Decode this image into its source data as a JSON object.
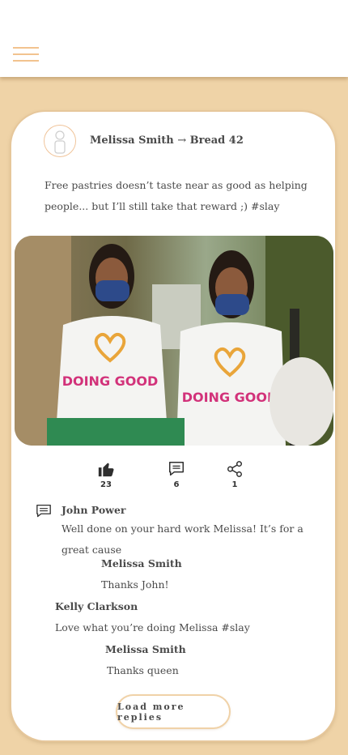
{
  "post": {
    "author": "Melissa Smith",
    "arrow": "→",
    "recipient": "Bread 42",
    "text": "Free pastries doesn’t taste near as good as helping people... but I’ll still take that reward ;) #slay",
    "image_alt": "Two volunteers in masks and DOING GOOD t-shirts holding a green bin and trash bag"
  },
  "stats": {
    "likes": "23",
    "comments": "6",
    "shares": "1"
  },
  "comments": [
    {
      "name": "John Power",
      "text": "Well done on your hard work Melissa! It’s for a great cause",
      "reply": {
        "name": "Melissa Smith",
        "text": "Thanks John!"
      }
    },
    {
      "name": "Kelly Clarkson",
      "text": "Love what you’re doing Melissa #slay",
      "reply": {
        "name": "Melissa Smith",
        "text": "Thanks queen"
      }
    }
  ],
  "load_more_label": "Load more replies",
  "shirt_text": "DOING GOOD",
  "colors": {
    "background": "#efd3a7",
    "accent": "#f2c38f",
    "card": "#ffffff",
    "text": "#4a4a4a"
  }
}
